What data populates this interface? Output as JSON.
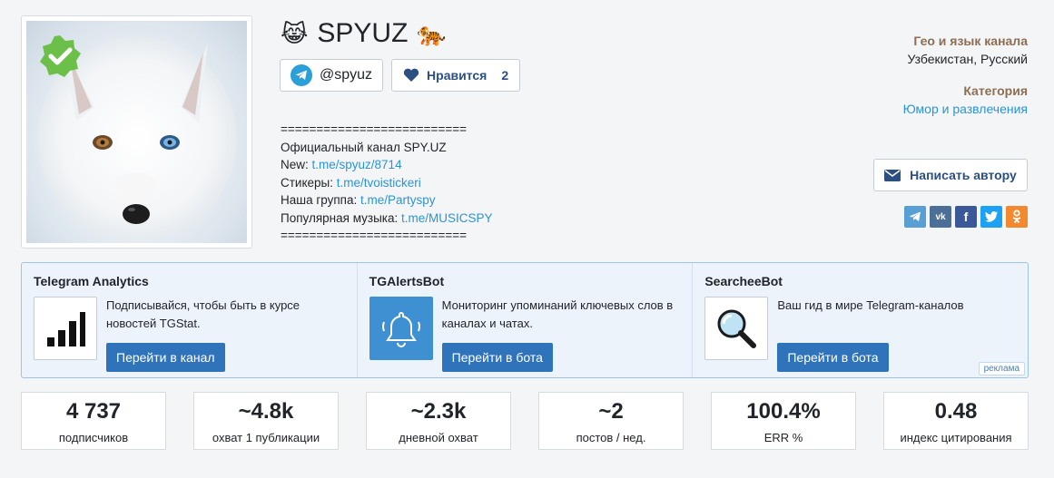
{
  "channel": {
    "title": "SPYUZ",
    "emoji_left": "😹",
    "emoji_right": "🐅",
    "handle": "@spyuz",
    "like_label": "Нравится",
    "like_count": "2"
  },
  "description": {
    "separator_top": "==========================",
    "line1": "Официальный канал SPY.UZ",
    "line2_label": "New: ",
    "line2_link": "t.me/spyuz/8714",
    "line3_label": "Стикеры: ",
    "line3_link": "t.me/tvoistickeri",
    "line4_label": "Наша группа: ",
    "line4_link": "t.me/Partyspy",
    "line5_label": "Популярная музыка: ",
    "line5_link": "t.me/MUSICSPY",
    "separator_bottom": "=========================="
  },
  "info": {
    "geo_label": "Гео и язык канала",
    "geo_value": "Узбекистан, Русский",
    "category_label": "Категория",
    "category_value": "Юмор и развлечения",
    "write_button": "Написать автору"
  },
  "share_icons": [
    "telegram-icon",
    "vk-icon",
    "facebook-icon",
    "twitter-icon",
    "odnoklassniki-icon"
  ],
  "ads": [
    {
      "title": "Telegram Analytics",
      "text": "Подписывайся, чтобы быть в курсе новостей TGStat.",
      "button": "Перейти в канал",
      "icon": "bar-chart-icon"
    },
    {
      "title": "TGAlertsBot",
      "text": "Мониторинг упоминаний ключевых слов в каналах и чатах.",
      "button": "Перейти в бота",
      "icon": "bell-icon"
    },
    {
      "title": "SearcheeBot",
      "text": "Ваш гид в мире Telegram-каналов",
      "button": "Перейти в бота",
      "icon": "magnifier-icon"
    }
  ],
  "ad_tag": "реклама",
  "stats": [
    {
      "value": "4 737",
      "label": "подписчиков"
    },
    {
      "value": "~4.8k",
      "label": "охват 1 публикации"
    },
    {
      "value": "~2.3k",
      "label": "дневной охват"
    },
    {
      "value": "~2",
      "label": "постов / нед."
    },
    {
      "value": "100.4%",
      "label": "ERR %"
    },
    {
      "value": "0.48",
      "label": "индекс цитирования"
    }
  ],
  "colors": {
    "accent_link": "#2a94d6",
    "button_blue": "#2f74bb",
    "label_brown": "#8d6e53",
    "verified_green": "#6cc04a"
  }
}
